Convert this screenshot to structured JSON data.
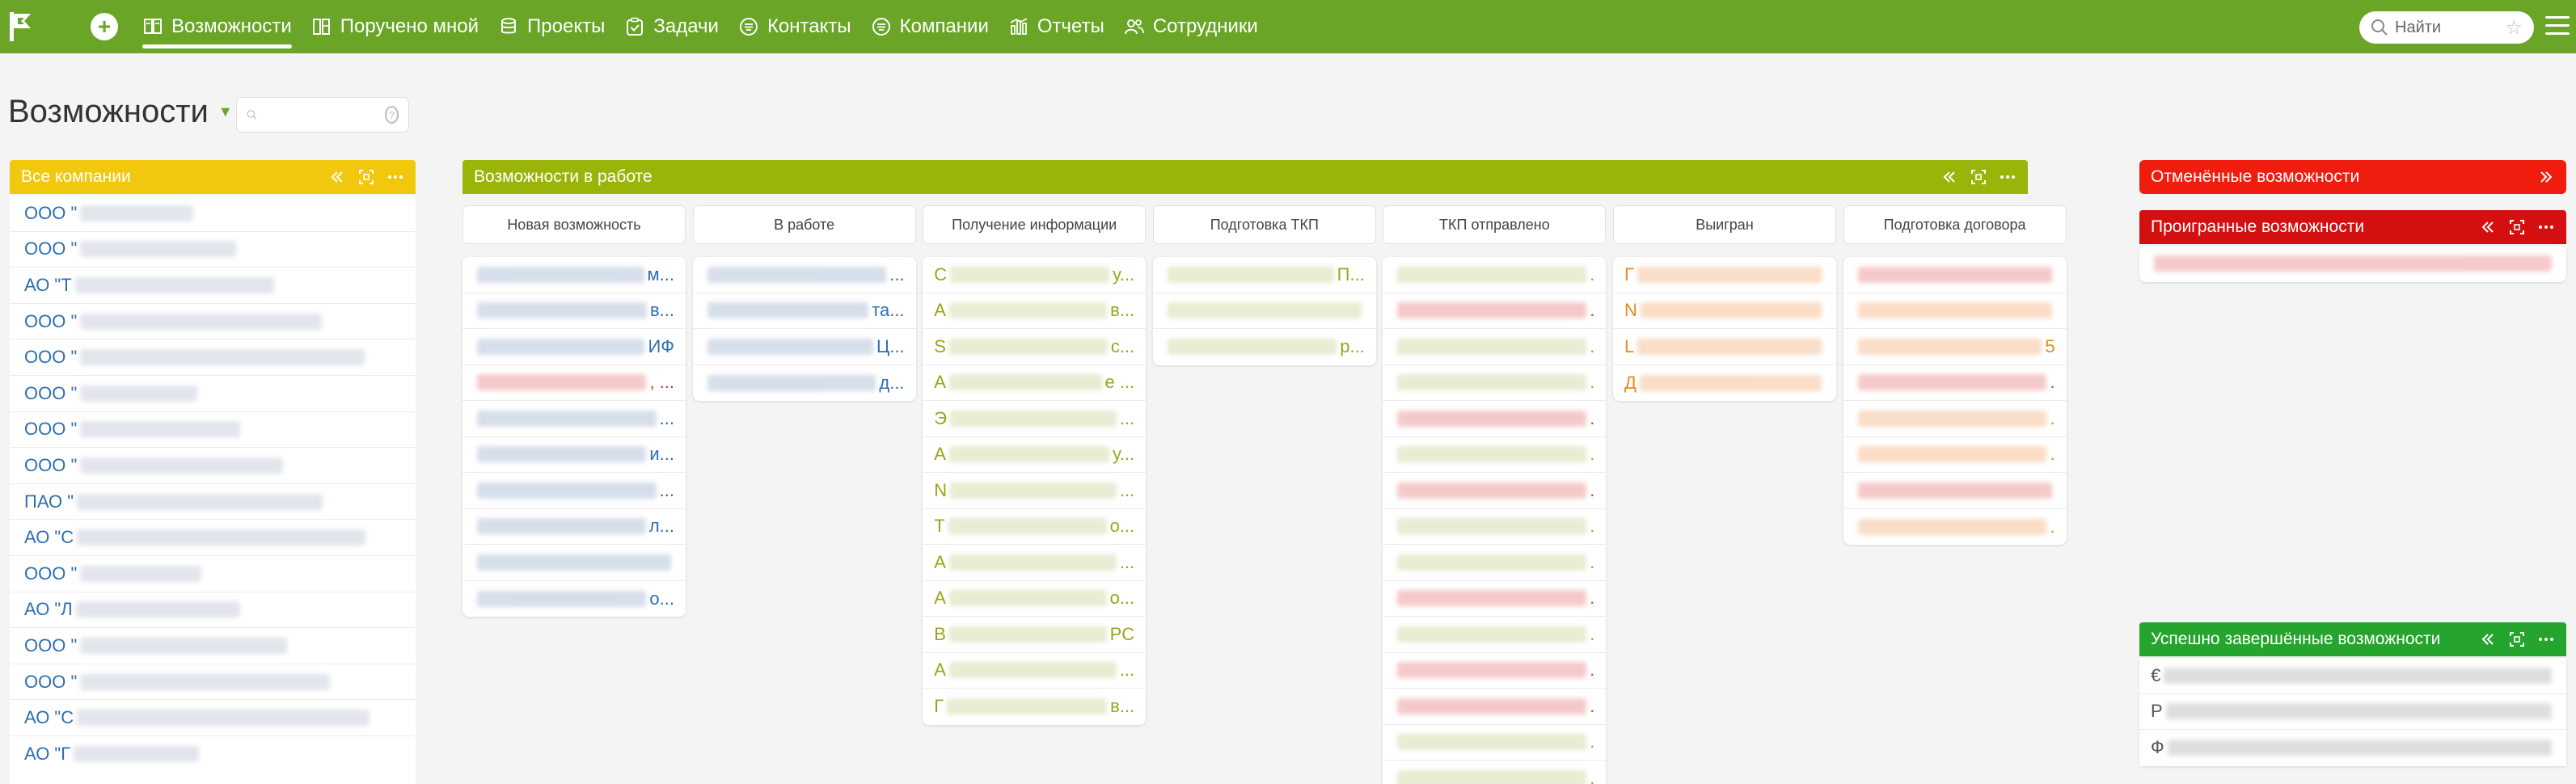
{
  "nav": {
    "items": [
      {
        "label": "Возможности",
        "icon": "book-icon",
        "active": true
      },
      {
        "label": "Поручено мной",
        "icon": "columns-icon",
        "active": false
      },
      {
        "label": "Проекты",
        "icon": "database-icon",
        "active": false
      },
      {
        "label": "Задачи",
        "icon": "clipboard-check-icon",
        "active": false
      },
      {
        "label": "Контакты",
        "icon": "contact-icon",
        "active": false
      },
      {
        "label": "Компании",
        "icon": "company-icon",
        "active": false
      },
      {
        "label": "Отчеты",
        "icon": "bar-chart-icon",
        "active": false
      },
      {
        "label": "Сотрудники",
        "icon": "people-icon",
        "active": false
      }
    ],
    "search_placeholder": "Найти"
  },
  "page": {
    "title": "Возможности",
    "search_placeholder": ""
  },
  "colors": {
    "topbar": "#6aa527",
    "companies": "#f2c80f",
    "in_work": "#9bb40a",
    "cancelled": "#f01d0f",
    "lost": "#d40f0f",
    "success": "#26a52e",
    "link_blue": "#2d6fb3",
    "olive_text": "#9aa616",
    "orange_text": "#e78a1c",
    "red_text": "#d8372f"
  },
  "groups": {
    "companies": {
      "title": "Все компании"
    },
    "in_work": {
      "title": "Возможности в работе"
    },
    "cancelled": {
      "title": "Отменённые возможности"
    },
    "lost": {
      "title": "Проигранные возможности"
    },
    "success": {
      "title": "Успешно завершённые возможности"
    }
  },
  "companies": [
    {
      "prefix": "ООО \"",
      "suffix": ""
    },
    {
      "prefix": "ООО \"",
      "suffix": ""
    },
    {
      "prefix": "АО \"Т",
      "suffix": ""
    },
    {
      "prefix": "ООО \"",
      "suffix": ""
    },
    {
      "prefix": "ООО \"",
      "suffix": ""
    },
    {
      "prefix": "ООО \"",
      "suffix": ""
    },
    {
      "prefix": "ООО \"",
      "suffix": ""
    },
    {
      "prefix": "ООО \"",
      "suffix": ""
    },
    {
      "prefix": "ПАО \"",
      "suffix": ""
    },
    {
      "prefix": "АО \"С",
      "suffix": ""
    },
    {
      "prefix": "ООО \"",
      "suffix": ""
    },
    {
      "prefix": "АО \"Л",
      "suffix": ""
    },
    {
      "prefix": "ООО \"",
      "suffix": ""
    },
    {
      "prefix": "ООО \"",
      "suffix": ""
    },
    {
      "prefix": "АО \"С",
      "suffix": ""
    },
    {
      "prefix": "АО \"Г",
      "suffix": ""
    }
  ],
  "columns": [
    {
      "title": "Новая возможность",
      "cards": [
        {
          "prefix": "",
          "suffix": "м...",
          "tone": "blue"
        },
        {
          "prefix": "",
          "suffix": "в...",
          "tone": "blue"
        },
        {
          "prefix": "",
          "suffix": "ИФ",
          "tone": "blue"
        },
        {
          "prefix": "",
          "suffix": ", ...",
          "tone": "red"
        },
        {
          "prefix": "",
          "suffix": "...",
          "tone": "blue"
        },
        {
          "prefix": "",
          "suffix": "и...",
          "tone": "blue"
        },
        {
          "prefix": "",
          "suffix": "...",
          "tone": "blue"
        },
        {
          "prefix": "",
          "suffix": "л...",
          "tone": "blue"
        },
        {
          "prefix": "",
          "suffix": "",
          "tone": "blue"
        },
        {
          "prefix": "",
          "suffix": "о...",
          "tone": "blue"
        }
      ]
    },
    {
      "title": "В работе",
      "cards": [
        {
          "prefix": "",
          "suffix": "...",
          "tone": "blue"
        },
        {
          "prefix": "",
          "suffix": "та...",
          "tone": "blue"
        },
        {
          "prefix": "",
          "suffix": "Ц...",
          "tone": "blue"
        },
        {
          "prefix": "",
          "suffix": "д...",
          "tone": "blue"
        }
      ]
    },
    {
      "title": "Получение информации",
      "cards": [
        {
          "prefix": "С",
          "suffix": "у...",
          "tone": "olive"
        },
        {
          "prefix": "А",
          "suffix": "в...",
          "tone": "olive"
        },
        {
          "prefix": "S",
          "suffix": "с...",
          "tone": "olive"
        },
        {
          "prefix": "А",
          "suffix": "е ...",
          "tone": "olive"
        },
        {
          "prefix": "Э",
          "suffix": "...",
          "tone": "olive"
        },
        {
          "prefix": "А",
          "suffix": "у...",
          "tone": "olive"
        },
        {
          "prefix": "N",
          "suffix": "...",
          "tone": "olive"
        },
        {
          "prefix": "Т",
          "suffix": "о...",
          "tone": "olive"
        },
        {
          "prefix": "А",
          "suffix": "...",
          "tone": "olive"
        },
        {
          "prefix": "А",
          "suffix": "о...",
          "tone": "olive"
        },
        {
          "prefix": "В",
          "suffix": "PC",
          "tone": "olive"
        },
        {
          "prefix": "А",
          "suffix": "...",
          "tone": "olive"
        },
        {
          "prefix": "Г",
          "suffix": "в...",
          "tone": "olive"
        }
      ]
    },
    {
      "title": "Подготовка ТКП",
      "cards": [
        {
          "prefix": "",
          "suffix": "П...",
          "tone": "olive"
        },
        {
          "prefix": "",
          "suffix": "",
          "tone": "olive"
        },
        {
          "prefix": "",
          "suffix": "р...",
          "tone": "olive"
        }
      ]
    },
    {
      "title": "ТКП отправлено",
      "cards": [
        {
          "prefix": "",
          "suffix": ".",
          "tone": "olive"
        },
        {
          "prefix": "",
          "suffix": ".",
          "tone": "red"
        },
        {
          "prefix": "",
          "suffix": ".",
          "tone": "olive"
        },
        {
          "prefix": "",
          "suffix": ".",
          "tone": "olive"
        },
        {
          "prefix": "",
          "suffix": ".",
          "tone": "red"
        },
        {
          "prefix": "",
          "suffix": ".",
          "tone": "olive"
        },
        {
          "prefix": "",
          "suffix": ".",
          "tone": "red"
        },
        {
          "prefix": "",
          "suffix": ".",
          "tone": "olive"
        },
        {
          "prefix": "",
          "suffix": ".",
          "tone": "olive"
        },
        {
          "prefix": "",
          "suffix": ".",
          "tone": "red"
        },
        {
          "prefix": "",
          "suffix": ".",
          "tone": "olive"
        },
        {
          "prefix": "",
          "suffix": ".",
          "tone": "red"
        },
        {
          "prefix": "",
          "suffix": ".",
          "tone": "red"
        },
        {
          "prefix": "",
          "suffix": ".",
          "tone": "olive"
        },
        {
          "prefix": "",
          "suffix": ".",
          "tone": "olive"
        }
      ]
    },
    {
      "title": "Выигран",
      "cards": [
        {
          "prefix": "Г",
          "suffix": "",
          "tone": "orange"
        },
        {
          "prefix": "N",
          "suffix": "",
          "tone": "orange"
        },
        {
          "prefix": "L",
          "suffix": "",
          "tone": "orange"
        },
        {
          "prefix": "Д",
          "suffix": "",
          "tone": "orange"
        }
      ]
    },
    {
      "title": "Подготовка договора",
      "cards": [
        {
          "prefix": "",
          "suffix": "",
          "tone": "red"
        },
        {
          "prefix": "",
          "suffix": "",
          "tone": "orange"
        },
        {
          "prefix": "",
          "suffix": "5",
          "tone": "orange"
        },
        {
          "prefix": "",
          "suffix": ".",
          "tone": "red"
        },
        {
          "prefix": "",
          "suffix": ".",
          "tone": "orange"
        },
        {
          "prefix": "",
          "suffix": ".",
          "tone": "orange"
        },
        {
          "prefix": "",
          "suffix": "",
          "tone": "red"
        },
        {
          "prefix": "",
          "suffix": ".",
          "tone": "orange"
        }
      ]
    }
  ],
  "lost_cards": [
    {
      "prefix": "",
      "suffix": "",
      "tone": "red"
    }
  ],
  "success_cards": [
    {
      "prefix": "€",
      "suffix": "",
      "tone": "gray"
    },
    {
      "prefix": "Р",
      "suffix": "",
      "tone": "gray"
    },
    {
      "prefix": "Ф",
      "suffix": "",
      "tone": "gray"
    }
  ]
}
